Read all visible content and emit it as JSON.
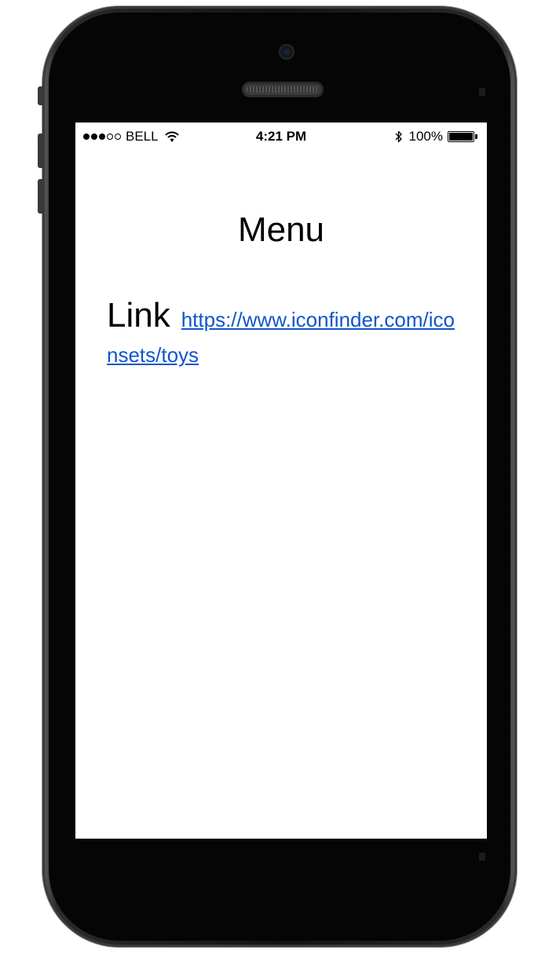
{
  "status_bar": {
    "carrier": "BELL",
    "signal_bars_full": 3,
    "signal_bars_total": 5,
    "time": "4:21 PM",
    "battery_percent": "100%",
    "battery_level": 1.0,
    "icons": [
      "signal-dots-icon",
      "wifi-icon",
      "bluetooth-icon",
      "battery-icon"
    ]
  },
  "page": {
    "title": "Menu",
    "link_label": "Link",
    "link_url": "https://www.iconfinder.com/iconsets/toys"
  },
  "colors": {
    "link": "#1155cc",
    "device": "#141414",
    "screen": "#ffffff"
  }
}
